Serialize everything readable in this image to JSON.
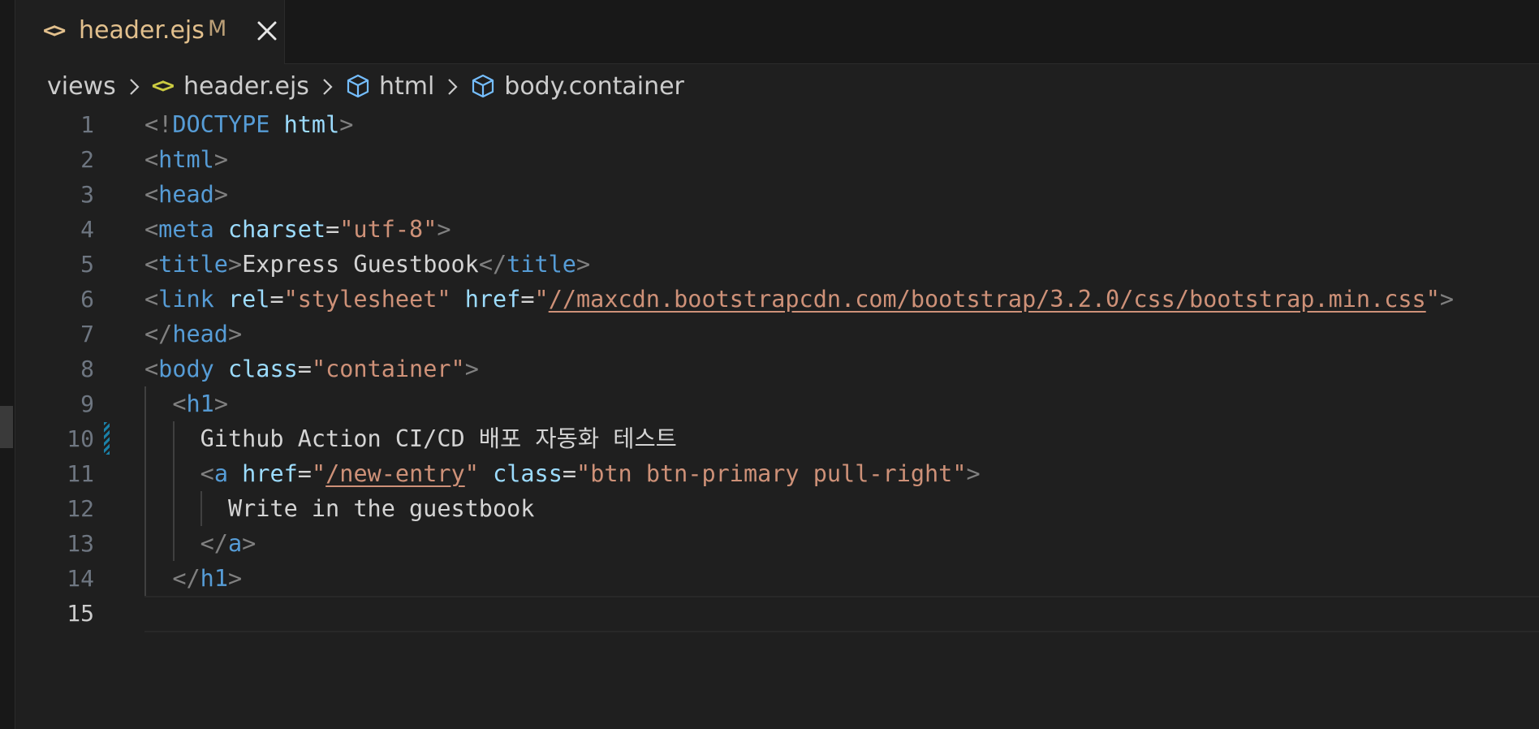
{
  "tab": {
    "icon": "<>",
    "filename": "header.ejs",
    "status": "M",
    "close_icon": "close-icon"
  },
  "breadcrumb": {
    "folder": "views",
    "file_icon": "<>",
    "file": "header.ejs",
    "html": "html",
    "body": "body.container"
  },
  "colors": {
    "tag": "#569cd6",
    "attribute": "#9cdcfe",
    "string": "#ce9178",
    "punctuation": "#808080",
    "text": "#d4d4d4",
    "modified_tab": "#e2c08d"
  },
  "editor": {
    "active_line": 15,
    "line_numbers": [
      "1",
      "2",
      "3",
      "4",
      "5",
      "6",
      "7",
      "8",
      "9",
      "10",
      "11",
      "12",
      "13",
      "14",
      "15"
    ],
    "lines": [
      [
        [
          "p",
          "<!"
        ],
        [
          "t",
          "DOCTYPE"
        ],
        [
          "txt",
          " "
        ],
        [
          "a",
          "html"
        ],
        [
          "p",
          ">"
        ]
      ],
      [
        [
          "p",
          "<"
        ],
        [
          "t",
          "html"
        ],
        [
          "p",
          ">"
        ]
      ],
      [
        [
          "p",
          "<"
        ],
        [
          "t",
          "head"
        ],
        [
          "p",
          ">"
        ]
      ],
      [
        [
          "p",
          "<"
        ],
        [
          "t",
          "meta"
        ],
        [
          "txt",
          " "
        ],
        [
          "a",
          "charset"
        ],
        [
          "txt",
          "="
        ],
        [
          "s",
          "\"utf-8\""
        ],
        [
          "p",
          ">"
        ]
      ],
      [
        [
          "p",
          "<"
        ],
        [
          "t",
          "title"
        ],
        [
          "p",
          ">"
        ],
        [
          "txt",
          "Express Guestbook"
        ],
        [
          "p",
          "</"
        ],
        [
          "t",
          "title"
        ],
        [
          "p",
          ">"
        ]
      ],
      [
        [
          "p",
          "<"
        ],
        [
          "t",
          "link"
        ],
        [
          "txt",
          " "
        ],
        [
          "a",
          "rel"
        ],
        [
          "txt",
          "="
        ],
        [
          "s",
          "\"stylesheet\""
        ],
        [
          "txt",
          " "
        ],
        [
          "a",
          "href"
        ],
        [
          "txt",
          "="
        ],
        [
          "s",
          "\""
        ],
        [
          "su",
          "//maxcdn.bootstrapcdn.com/bootstrap/3.2.0/css/bootstrap.min.css"
        ],
        [
          "s",
          "\""
        ],
        [
          "p",
          ">"
        ]
      ],
      [
        [
          "p",
          "</"
        ],
        [
          "t",
          "head"
        ],
        [
          "p",
          ">"
        ]
      ],
      [
        [
          "p",
          "<"
        ],
        [
          "t",
          "body"
        ],
        [
          "txt",
          " "
        ],
        [
          "a",
          "class"
        ],
        [
          "txt",
          "="
        ],
        [
          "s",
          "\"container\""
        ],
        [
          "p",
          ">"
        ]
      ],
      [
        [
          "txt",
          "  "
        ],
        [
          "p",
          "<"
        ],
        [
          "t",
          "h1"
        ],
        [
          "p",
          ">"
        ]
      ],
      [
        [
          "txt",
          "    Github Action CI/CD 배포 자동화 테스트"
        ]
      ],
      [
        [
          "txt",
          "    "
        ],
        [
          "p",
          "<"
        ],
        [
          "t",
          "a"
        ],
        [
          "txt",
          " "
        ],
        [
          "a",
          "href"
        ],
        [
          "txt",
          "="
        ],
        [
          "s",
          "\""
        ],
        [
          "su",
          "/new-entry"
        ],
        [
          "s",
          "\""
        ],
        [
          "txt",
          " "
        ],
        [
          "a",
          "class"
        ],
        [
          "txt",
          "="
        ],
        [
          "s",
          "\"btn btn-primary pull-right\""
        ],
        [
          "p",
          ">"
        ]
      ],
      [
        [
          "txt",
          "      Write in the guestbook"
        ]
      ],
      [
        [
          "txt",
          "    "
        ],
        [
          "p",
          "</"
        ],
        [
          "t",
          "a"
        ],
        [
          "p",
          ">"
        ]
      ],
      [
        [
          "txt",
          "  "
        ],
        [
          "p",
          "</"
        ],
        [
          "t",
          "h1"
        ],
        [
          "p",
          ">"
        ]
      ],
      []
    ]
  }
}
